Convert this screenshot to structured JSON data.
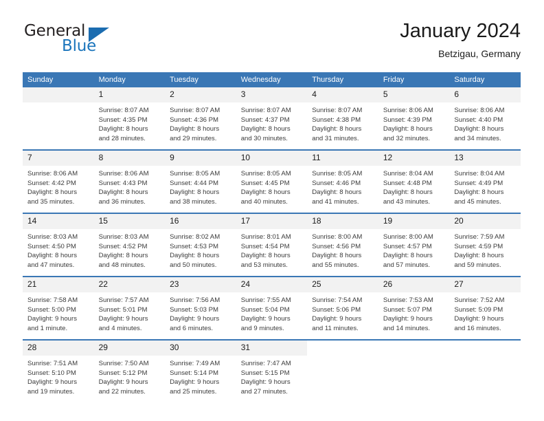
{
  "brand": {
    "name_part1": "General",
    "name_part2": "Blue",
    "triangle_icon": "triangle-icon",
    "accent_color": "#1b75bc"
  },
  "header": {
    "title": "January 2024",
    "subtitle": "Betzigau, Germany"
  },
  "theme": {
    "header_blue": "#3a77b5",
    "daynum_band": "#f2f2f2",
    "text": "#3b3b3b"
  },
  "weekdays": [
    "Sunday",
    "Monday",
    "Tuesday",
    "Wednesday",
    "Thursday",
    "Friday",
    "Saturday"
  ],
  "weeks": [
    [
      {
        "day": "",
        "empty": true,
        "lines": [
          "",
          "",
          "",
          ""
        ]
      },
      {
        "day": "1",
        "lines": [
          "Sunrise: 8:07 AM",
          "Sunset: 4:35 PM",
          "Daylight: 8 hours",
          "and 28 minutes."
        ]
      },
      {
        "day": "2",
        "lines": [
          "Sunrise: 8:07 AM",
          "Sunset: 4:36 PM",
          "Daylight: 8 hours",
          "and 29 minutes."
        ]
      },
      {
        "day": "3",
        "lines": [
          "Sunrise: 8:07 AM",
          "Sunset: 4:37 PM",
          "Daylight: 8 hours",
          "and 30 minutes."
        ]
      },
      {
        "day": "4",
        "lines": [
          "Sunrise: 8:07 AM",
          "Sunset: 4:38 PM",
          "Daylight: 8 hours",
          "and 31 minutes."
        ]
      },
      {
        "day": "5",
        "lines": [
          "Sunrise: 8:06 AM",
          "Sunset: 4:39 PM",
          "Daylight: 8 hours",
          "and 32 minutes."
        ]
      },
      {
        "day": "6",
        "lines": [
          "Sunrise: 8:06 AM",
          "Sunset: 4:40 PM",
          "Daylight: 8 hours",
          "and 34 minutes."
        ]
      }
    ],
    [
      {
        "day": "7",
        "lines": [
          "Sunrise: 8:06 AM",
          "Sunset: 4:42 PM",
          "Daylight: 8 hours",
          "and 35 minutes."
        ]
      },
      {
        "day": "8",
        "lines": [
          "Sunrise: 8:06 AM",
          "Sunset: 4:43 PM",
          "Daylight: 8 hours",
          "and 36 minutes."
        ]
      },
      {
        "day": "9",
        "lines": [
          "Sunrise: 8:05 AM",
          "Sunset: 4:44 PM",
          "Daylight: 8 hours",
          "and 38 minutes."
        ]
      },
      {
        "day": "10",
        "lines": [
          "Sunrise: 8:05 AM",
          "Sunset: 4:45 PM",
          "Daylight: 8 hours",
          "and 40 minutes."
        ]
      },
      {
        "day": "11",
        "lines": [
          "Sunrise: 8:05 AM",
          "Sunset: 4:46 PM",
          "Daylight: 8 hours",
          "and 41 minutes."
        ]
      },
      {
        "day": "12",
        "lines": [
          "Sunrise: 8:04 AM",
          "Sunset: 4:48 PM",
          "Daylight: 8 hours",
          "and 43 minutes."
        ]
      },
      {
        "day": "13",
        "lines": [
          "Sunrise: 8:04 AM",
          "Sunset: 4:49 PM",
          "Daylight: 8 hours",
          "and 45 minutes."
        ]
      }
    ],
    [
      {
        "day": "14",
        "lines": [
          "Sunrise: 8:03 AM",
          "Sunset: 4:50 PM",
          "Daylight: 8 hours",
          "and 47 minutes."
        ]
      },
      {
        "day": "15",
        "lines": [
          "Sunrise: 8:03 AM",
          "Sunset: 4:52 PM",
          "Daylight: 8 hours",
          "and 48 minutes."
        ]
      },
      {
        "day": "16",
        "lines": [
          "Sunrise: 8:02 AM",
          "Sunset: 4:53 PM",
          "Daylight: 8 hours",
          "and 50 minutes."
        ]
      },
      {
        "day": "17",
        "lines": [
          "Sunrise: 8:01 AM",
          "Sunset: 4:54 PM",
          "Daylight: 8 hours",
          "and 53 minutes."
        ]
      },
      {
        "day": "18",
        "lines": [
          "Sunrise: 8:00 AM",
          "Sunset: 4:56 PM",
          "Daylight: 8 hours",
          "and 55 minutes."
        ]
      },
      {
        "day": "19",
        "lines": [
          "Sunrise: 8:00 AM",
          "Sunset: 4:57 PM",
          "Daylight: 8 hours",
          "and 57 minutes."
        ]
      },
      {
        "day": "20",
        "lines": [
          "Sunrise: 7:59 AM",
          "Sunset: 4:59 PM",
          "Daylight: 8 hours",
          "and 59 minutes."
        ]
      }
    ],
    [
      {
        "day": "21",
        "lines": [
          "Sunrise: 7:58 AM",
          "Sunset: 5:00 PM",
          "Daylight: 9 hours",
          "and 1 minute."
        ]
      },
      {
        "day": "22",
        "lines": [
          "Sunrise: 7:57 AM",
          "Sunset: 5:01 PM",
          "Daylight: 9 hours",
          "and 4 minutes."
        ]
      },
      {
        "day": "23",
        "lines": [
          "Sunrise: 7:56 AM",
          "Sunset: 5:03 PM",
          "Daylight: 9 hours",
          "and 6 minutes."
        ]
      },
      {
        "day": "24",
        "lines": [
          "Sunrise: 7:55 AM",
          "Sunset: 5:04 PM",
          "Daylight: 9 hours",
          "and 9 minutes."
        ]
      },
      {
        "day": "25",
        "lines": [
          "Sunrise: 7:54 AM",
          "Sunset: 5:06 PM",
          "Daylight: 9 hours",
          "and 11 minutes."
        ]
      },
      {
        "day": "26",
        "lines": [
          "Sunrise: 7:53 AM",
          "Sunset: 5:07 PM",
          "Daylight: 9 hours",
          "and 14 minutes."
        ]
      },
      {
        "day": "27",
        "lines": [
          "Sunrise: 7:52 AM",
          "Sunset: 5:09 PM",
          "Daylight: 9 hours",
          "and 16 minutes."
        ]
      }
    ],
    [
      {
        "day": "28",
        "lines": [
          "Sunrise: 7:51 AM",
          "Sunset: 5:10 PM",
          "Daylight: 9 hours",
          "and 19 minutes."
        ]
      },
      {
        "day": "29",
        "lines": [
          "Sunrise: 7:50 AM",
          "Sunset: 5:12 PM",
          "Daylight: 9 hours",
          "and 22 minutes."
        ]
      },
      {
        "day": "30",
        "lines": [
          "Sunrise: 7:49 AM",
          "Sunset: 5:14 PM",
          "Daylight: 9 hours",
          "and 25 minutes."
        ]
      },
      {
        "day": "31",
        "lines": [
          "Sunrise: 7:47 AM",
          "Sunset: 5:15 PM",
          "Daylight: 9 hours",
          "and 27 minutes."
        ]
      },
      {
        "day": "",
        "blank": true,
        "lines": [
          "",
          "",
          "",
          ""
        ]
      },
      {
        "day": "",
        "blank": true,
        "lines": [
          "",
          "",
          "",
          ""
        ]
      },
      {
        "day": "",
        "blank": true,
        "lines": [
          "",
          "",
          "",
          ""
        ]
      }
    ]
  ]
}
